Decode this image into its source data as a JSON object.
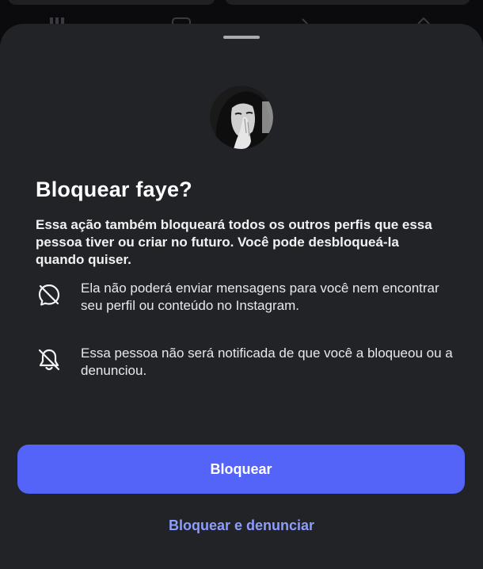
{
  "dialog": {
    "title": "Bloquear faye?",
    "description": "Essa ação também bloqueará todos os outros perfis que essa pessoa tiver ou criar no futuro. Você pode desbloqueá-la quando quiser.",
    "info_items": [
      {
        "icon": "message-blocked-icon",
        "text": "Ela não poderá enviar mensagens para você nem encontrar seu perfil ou conteúdo no Instagram."
      },
      {
        "icon": "notification-off-icon",
        "text": "Essa pessoa não será notificada de que você a bloqueou ou a denunciou."
      }
    ],
    "primary_button": "Bloquear",
    "secondary_link": "Bloquear e denunciar"
  },
  "colors": {
    "sheet_background": "#212327",
    "accent": "#5464f9",
    "link": "#8c9dfc"
  }
}
